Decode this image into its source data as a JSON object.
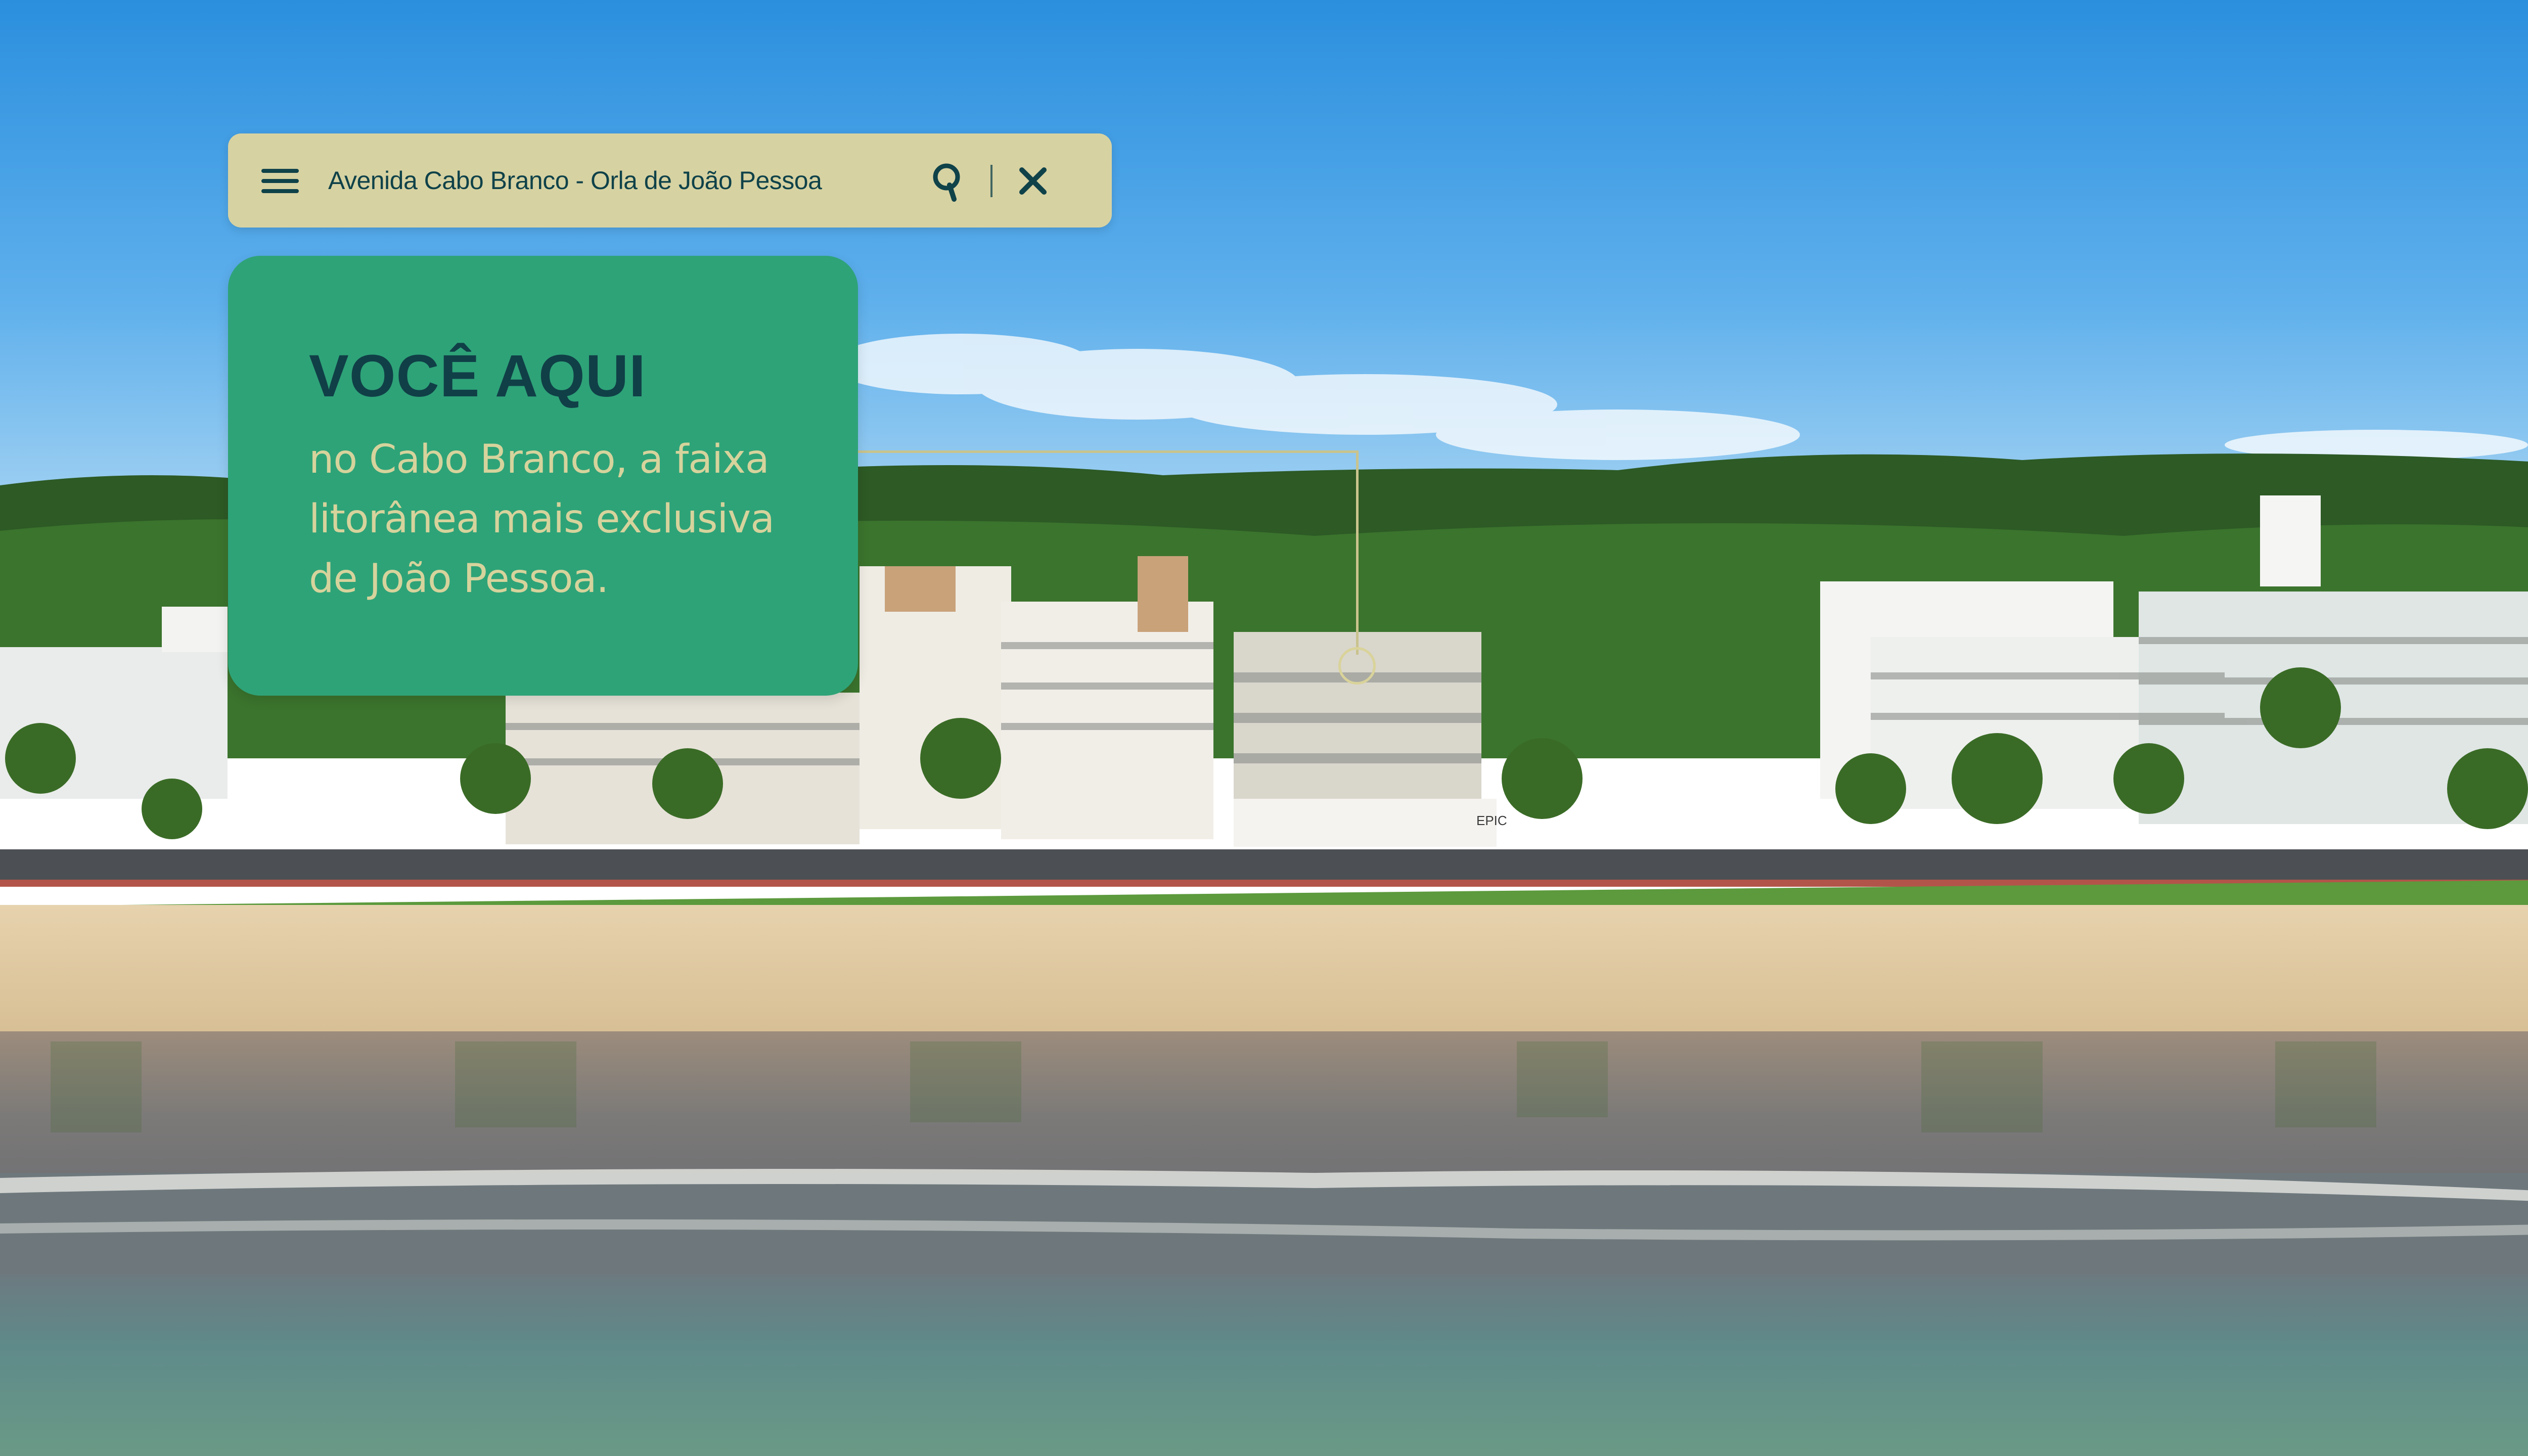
{
  "search_bar": {
    "location_text": "Avenida Cabo Branco - Orla de João Pessoa",
    "menu_icon": "hamburger-menu-icon",
    "search_icon": "search-icon",
    "close_icon": "close-icon",
    "background_color": "#d7d2a2",
    "icon_color": "#0f4249"
  },
  "info_card": {
    "title": "VOCÊ AQUI",
    "description": "no Cabo Branco, a faixa litorânea mais exclusiva de João Pessoa.",
    "background_color": "#2ea378",
    "title_color": "#103f47",
    "text_color": "#d6d39c"
  },
  "building_sign": "EPIC",
  "locator": {
    "marker": "location-ring-icon",
    "line_color": "#c9c38e"
  }
}
